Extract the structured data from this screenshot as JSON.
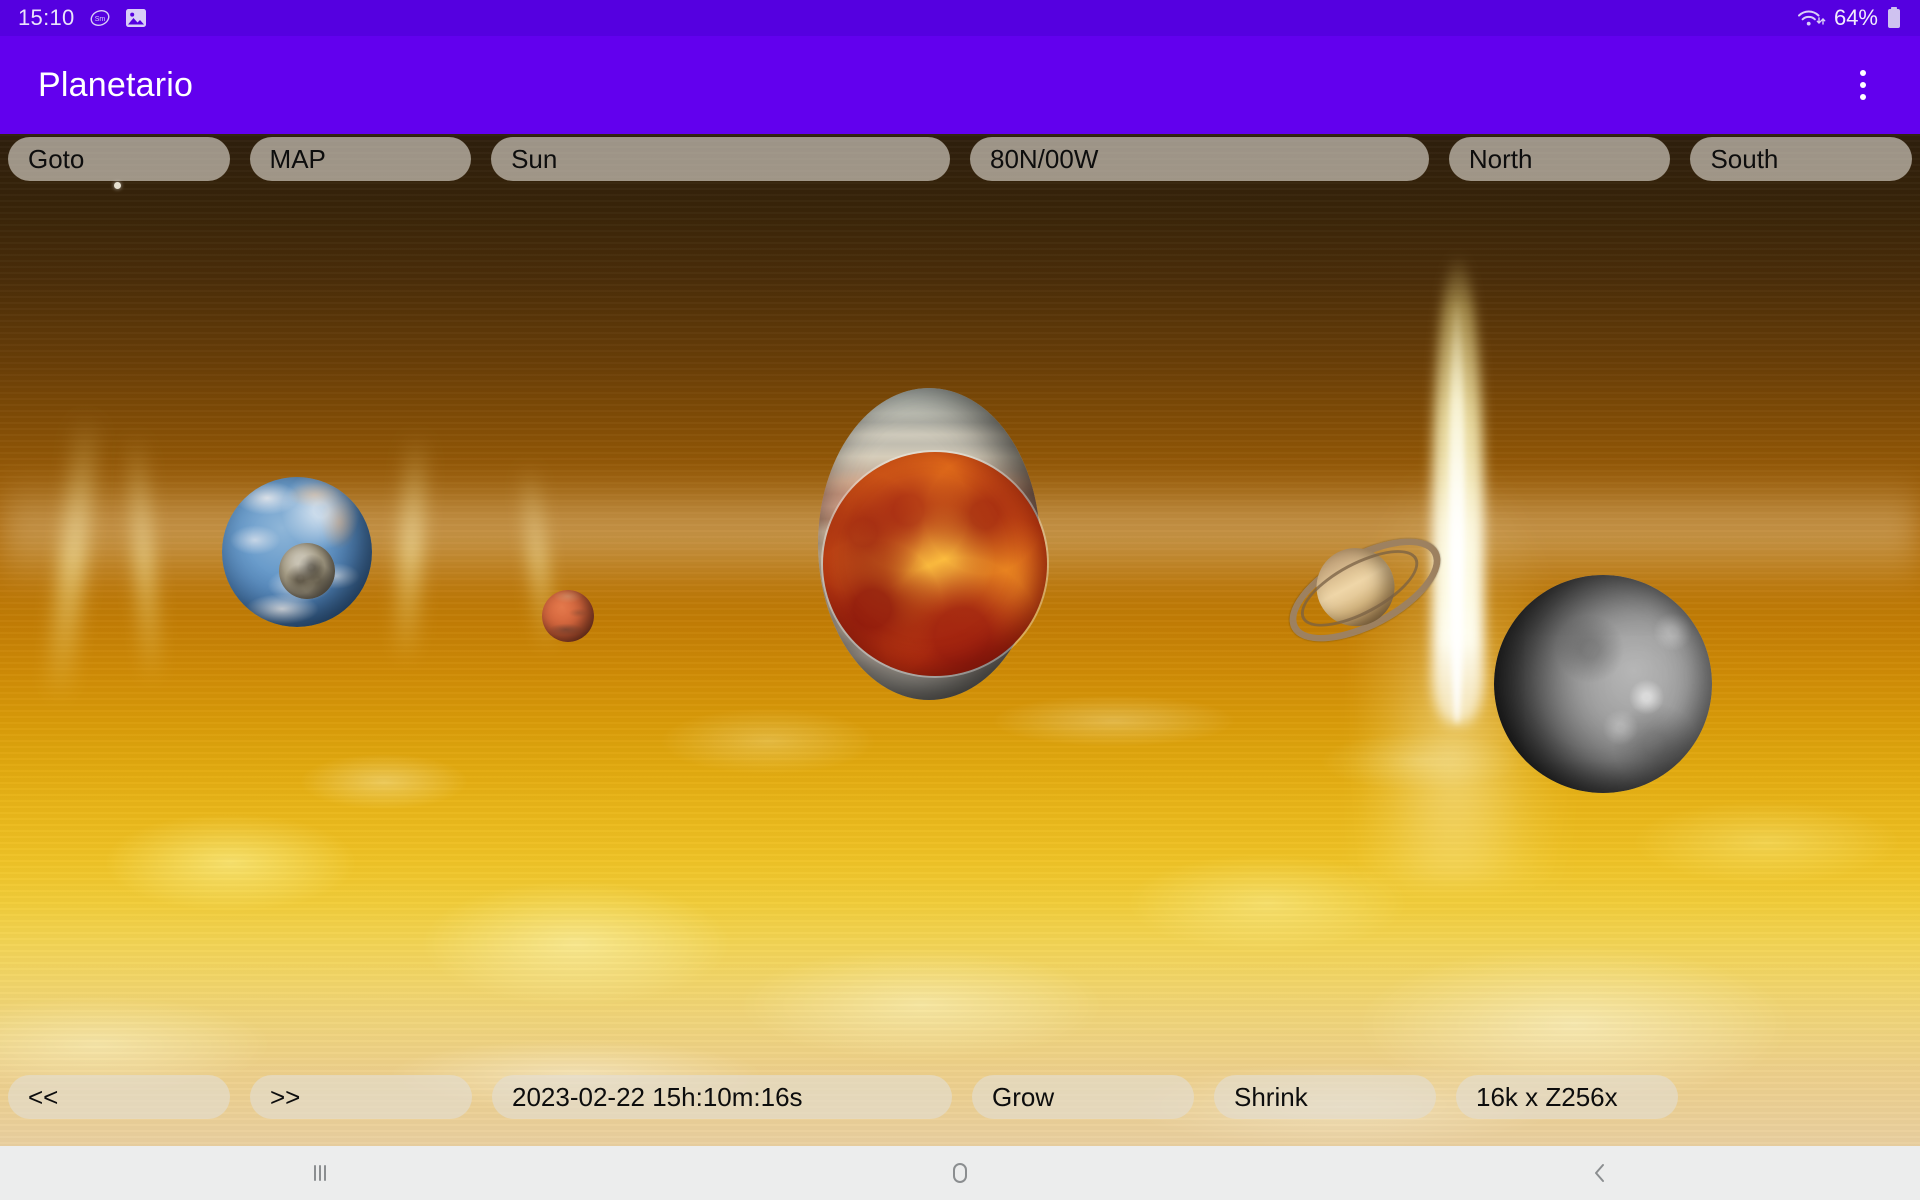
{
  "status_bar": {
    "clock": "15:10",
    "battery_percent": "64%",
    "icons": [
      "app-badge-icon",
      "gallery-icon",
      "wifi-icon",
      "battery-icon"
    ]
  },
  "app_bar": {
    "title": "Planetario",
    "overflow_menu": "overflow-menu-icon",
    "background_color": "#6200ee"
  },
  "top_toolbar": {
    "buttons": [
      {
        "label": "Goto",
        "name": "goto-button",
        "width": "w-sm"
      },
      {
        "label": "MAP",
        "name": "map-button",
        "width": "w-sm"
      },
      {
        "label": "Sun",
        "name": "target-body-button",
        "width": "w-lg"
      },
      {
        "label": "80N/00W",
        "name": "coordinates-button",
        "width": "w-lg"
      },
      {
        "label": "North",
        "name": "north-button",
        "width": "w-md"
      },
      {
        "label": "South",
        "name": "south-button",
        "width": "w-md"
      }
    ]
  },
  "bottom_toolbar": {
    "buttons": [
      {
        "label": "<<",
        "name": "step-back-button",
        "width": "w-sm"
      },
      {
        "label": ">>",
        "name": "step-forward-button",
        "width": "w-sm"
      },
      {
        "label": "2023-02-22 15h:10m:16s",
        "name": "datetime-display",
        "width": "w-lg"
      },
      {
        "label": "Grow",
        "name": "grow-button",
        "width": "w-md"
      },
      {
        "label": "Shrink",
        "name": "shrink-button",
        "width": "w-md"
      },
      {
        "label": "16k x Z256x",
        "name": "zoom-level-display",
        "width": "w-md"
      }
    ]
  },
  "scene": {
    "background": "sun-surface-photo",
    "background_colors": {
      "top": "#2e1f0d",
      "mid": "#cf8b06",
      "bottom": "#ead0a0"
    },
    "bodies": [
      {
        "name": "earth",
        "label": "Earth"
      },
      {
        "name": "moon",
        "label": "Moon"
      },
      {
        "name": "mars",
        "label": "Mars"
      },
      {
        "name": "venus",
        "label": "Venus"
      },
      {
        "name": "jupiter",
        "label": "Jupiter"
      },
      {
        "name": "saturn",
        "label": "Saturn"
      },
      {
        "name": "mercury",
        "label": "Mercury"
      }
    ],
    "features": [
      "solar-prominence",
      "sky-point-object"
    ]
  },
  "nav_bar": {
    "recents": "recents-icon",
    "home": "home-icon",
    "back": "back-icon",
    "background_color": "#eceded"
  }
}
